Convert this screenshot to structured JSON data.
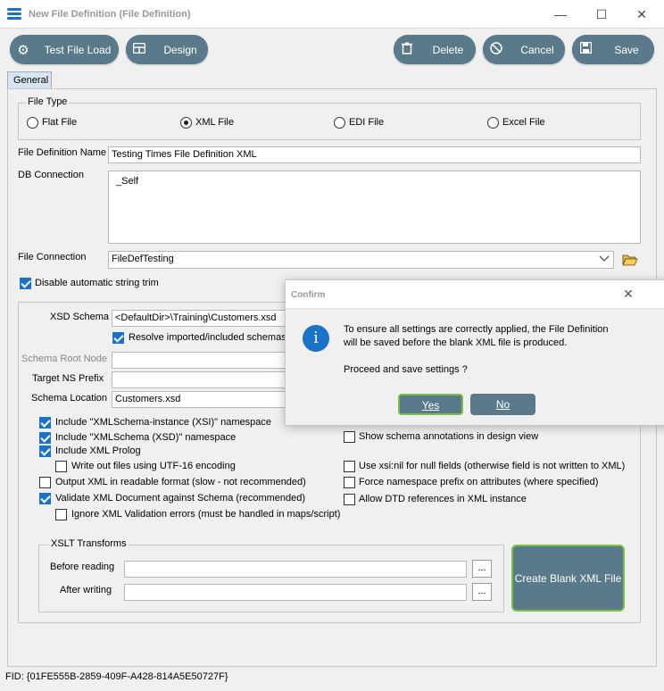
{
  "window": {
    "title": "New File Definition (File Definition)",
    "minimize": "—",
    "maximize": "☐",
    "close": "✕"
  },
  "toolbar": {
    "test_file_load": "Test File Load",
    "design": "Design",
    "delete": "Delete",
    "cancel": "Cancel",
    "save": "Save"
  },
  "tabs": {
    "general": "General"
  },
  "file_type": {
    "title": "File Type",
    "options": [
      "Flat File",
      "XML File",
      "EDI File",
      "Excel File"
    ],
    "selected": "XML File"
  },
  "fields": {
    "file_def_name_label": "File Definition Name",
    "file_def_name_value": "Testing Times File Definition XML",
    "db_connection_label": "DB Connection",
    "db_connection_value": "_Self",
    "file_connection_label": "File Connection",
    "file_connection_value": "FileDefTesting",
    "disable_trim": "Disable automatic string trim"
  },
  "xml": {
    "xsd_schema_label": "XSD Schema",
    "xsd_schema_value": "<DefaultDir>\\Training\\Customers.xsd",
    "resolve_imported": "Resolve imported/included schemas (",
    "schema_root_node_label": "Schema Root Node",
    "target_ns_prefix_label": "Target NS Prefix",
    "schema_location_label": "Schema Location",
    "schema_location_value": "Customers.xsd"
  },
  "options_left": [
    {
      "label": "Include \"XMLSchema-instance (XSI)\" namespace",
      "checked": true
    },
    {
      "label": "Include \"XMLSchema (XSD)\" namespace",
      "checked": true
    },
    {
      "label": "Include XML Prolog",
      "checked": true
    },
    {
      "label": "Write out files using UTF-16 encoding",
      "checked": false
    },
    {
      "label": "Output XML in readable format (slow - not recommended)",
      "checked": false
    },
    {
      "label": "Validate XML Document against Schema (recommended)",
      "checked": true
    },
    {
      "label": "Ignore XML Validation errors (must be handled in maps/script)",
      "checked": false
    }
  ],
  "options_right": [
    {
      "label": "Show schema annotations in design view",
      "checked": false
    },
    {
      "label": "Use xsi:nil for null fields (otherwise field is not written to XML)",
      "checked": false
    },
    {
      "label": "Force namespace prefix on attributes (where specified)",
      "checked": false
    },
    {
      "label": "Allow DTD references in XML instance",
      "checked": false
    }
  ],
  "xslt": {
    "title": "XSLT Transforms",
    "before_reading": "Before reading",
    "after_writing": "After writing",
    "browse": "..."
  },
  "create_blank": "Create Blank XML File",
  "status": "FID: {01FE555B-2859-409F-A428-814A5E50727F}",
  "dialog": {
    "title": "Confirm",
    "close": "✕",
    "icon": "i",
    "message_line1": "To ensure all settings are correctly applied, the File Definition",
    "message_line2": "will be saved before the blank XML file is produced.",
    "question": "Proceed and save settings ?",
    "yes": "Yes",
    "no": "No"
  },
  "colors": {
    "button_bg": "#5a7a8c",
    "accent_green": "#7ac142",
    "checkbox_blue": "#1a73c8",
    "info_blue": "#1a73c8"
  }
}
